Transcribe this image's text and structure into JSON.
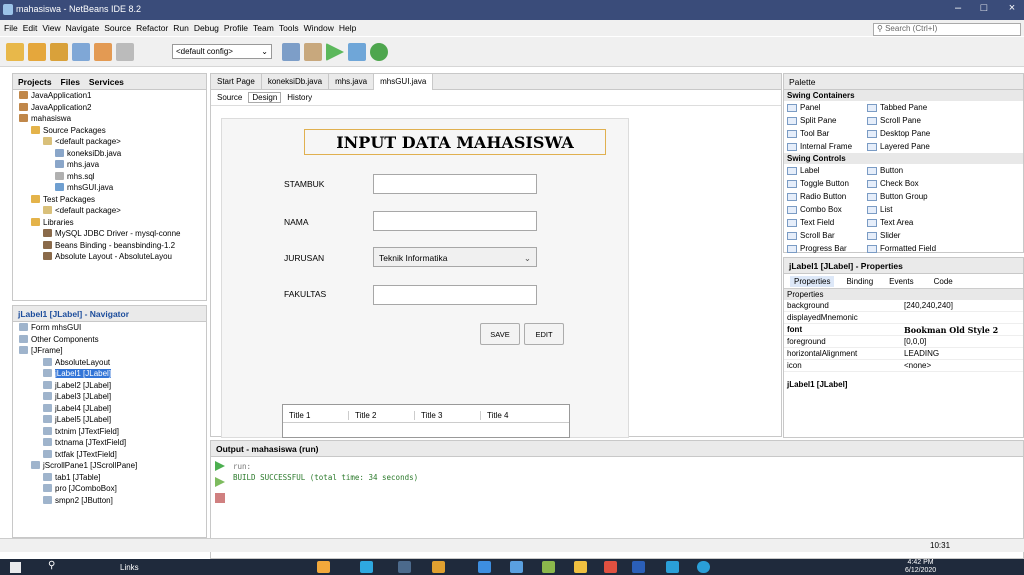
{
  "window": {
    "title": "mahasiswa - NetBeans IDE 8.2"
  },
  "menu": [
    "File",
    "Edit",
    "View",
    "Navigate",
    "Source",
    "Refactor",
    "Run",
    "Debug",
    "Profile",
    "Team",
    "Tools",
    "Window",
    "Help"
  ],
  "search": {
    "placeholder": "Search (Ctrl+I)"
  },
  "toolbar": {
    "config": "<default config>"
  },
  "projects": {
    "tabs": [
      "Projects",
      "Files",
      "Services"
    ],
    "tree": [
      {
        "label": "JavaApplication1",
        "indent": 0,
        "icon": "coffee"
      },
      {
        "label": "JavaApplication2",
        "indent": 0,
        "icon": "coffee"
      },
      {
        "label": "mahasiswa",
        "indent": 0,
        "icon": "coffee"
      },
      {
        "label": "Source Packages",
        "indent": 1,
        "icon": "folder"
      },
      {
        "label": "<default package>",
        "indent": 2,
        "icon": "package"
      },
      {
        "label": "koneksiDb.java",
        "indent": 3,
        "icon": "java"
      },
      {
        "label": "mhs.java",
        "indent": 3,
        "icon": "java"
      },
      {
        "label": "mhs.sql",
        "indent": 3,
        "icon": "file"
      },
      {
        "label": "mhsGUI.java",
        "indent": 3,
        "icon": "form"
      },
      {
        "label": "Test Packages",
        "indent": 1,
        "icon": "folder"
      },
      {
        "label": "<default package>",
        "indent": 2,
        "icon": "package"
      },
      {
        "label": "Libraries",
        "indent": 1,
        "icon": "folder"
      },
      {
        "label": "MySQL JDBC Driver - mysql-conne",
        "indent": 2,
        "icon": "jar"
      },
      {
        "label": "Beans Binding - beansbinding-1.2",
        "indent": 2,
        "icon": "jar"
      },
      {
        "label": "Absolute Layout - AbsoluteLayou",
        "indent": 2,
        "icon": "jar"
      }
    ]
  },
  "navigator": {
    "title": "jLabel1 [JLabel] - Navigator",
    "tree": [
      {
        "label": "Form mhsGUI",
        "indent": 0
      },
      {
        "label": "Other Components",
        "indent": 0
      },
      {
        "label": "[JFrame]",
        "indent": 0
      },
      {
        "label": "AbsoluteLayout",
        "indent": 2
      },
      {
        "label": "jLabel1 [JLabel]",
        "indent": 2,
        "selected": true
      },
      {
        "label": "jLabel2 [JLabel]",
        "indent": 2
      },
      {
        "label": "jLabel3 [JLabel]",
        "indent": 2
      },
      {
        "label": "jLabel4 [JLabel]",
        "indent": 2
      },
      {
        "label": "jLabel5 [JLabel]",
        "indent": 2
      },
      {
        "label": "txtnim [JTextField]",
        "indent": 2
      },
      {
        "label": "txtnama [JTextField]",
        "indent": 2
      },
      {
        "label": "txtfak [JTextField]",
        "indent": 2
      },
      {
        "label": "jScrollPane1 [JScrollPane]",
        "indent": 1
      },
      {
        "label": "tab1 [JTable]",
        "indent": 2
      },
      {
        "label": "pro [JComboBox]",
        "indent": 2
      },
      {
        "label": "smpn2 [JButton]",
        "indent": 2
      }
    ]
  },
  "editor": {
    "tabs": [
      "Start Page",
      "koneksiDb.java",
      "mhs.java",
      "mhsGUI.java"
    ],
    "subtabs": [
      "Source",
      "Design",
      "History"
    ],
    "form": {
      "title": "INPUT DATA MAHASISWA",
      "labels": [
        "STAMBUK",
        "NAMA",
        "JURUSAN",
        "FAKULTAS"
      ],
      "jurusan_value": "Teknik Informatika",
      "save": "SAVE",
      "edit": "EDIT",
      "table_headers": [
        "Title 1",
        "Title 2",
        "Title 3",
        "Title 4"
      ]
    }
  },
  "palette": {
    "title": "Palette",
    "sections": [
      {
        "name": "Swing Containers",
        "items": [
          "Panel",
          "Tabbed Pane",
          "Split Pane",
          "Scroll Pane",
          "Tool Bar",
          "Desktop Pane",
          "Internal Frame",
          "Layered Pane"
        ]
      },
      {
        "name": "Swing Controls",
        "items": [
          "Label",
          "Button",
          "Toggle Button",
          "Check Box",
          "Radio Button",
          "Button Group",
          "Combo Box",
          "List",
          "Text Field",
          "Text Area",
          "Scroll Bar",
          "Slider",
          "Progress Bar",
          "Formatted Field",
          "Password Field"
        ]
      }
    ]
  },
  "properties": {
    "title": "jLabel1 [JLabel] - Properties",
    "tabs": [
      "Properties",
      "Binding",
      "Events",
      "Code"
    ],
    "section": "Properties",
    "rows": [
      {
        "k": "background",
        "v": "[240,240,240]"
      },
      {
        "k": "displayedMnemonic",
        "v": ""
      },
      {
        "k": "font",
        "v": "Bookman Old Style 2"
      },
      {
        "k": "foreground",
        "v": "[0,0,0]"
      },
      {
        "k": "horizontalAlignment",
        "v": "LEADING"
      },
      {
        "k": "icon",
        "v": "<none>"
      }
    ],
    "footer": "jLabel1 [JLabel]"
  },
  "output": {
    "title": "Output - mahasiswa (run)",
    "lines": [
      "run:",
      "BUILD SUCCESSFUL (total time: 34 seconds)"
    ]
  },
  "status": {
    "pos": "10:31"
  },
  "taskbar": {
    "links": "Links",
    "time": "4:42 PM",
    "date": "6/12/2020"
  }
}
